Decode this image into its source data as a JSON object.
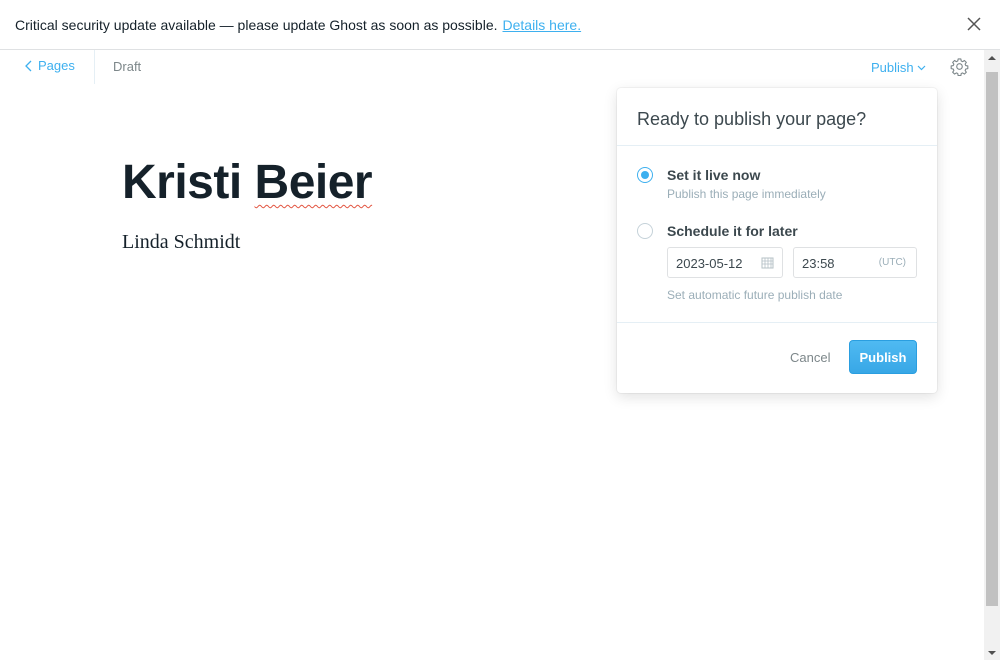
{
  "notice": {
    "text": "Critical security update available — please update Ghost as soon as possible.",
    "link": "Details here.",
    "close_icon": "close-icon"
  },
  "header": {
    "back_label": "Pages",
    "status": "Draft",
    "publish_label": "Publish",
    "settings_icon": "gear-icon"
  },
  "editor": {
    "title_part1": "Kristi ",
    "title_part2": "Beier",
    "body": "Linda Schmidt"
  },
  "popover": {
    "title": "Ready to publish your page?",
    "options": [
      {
        "label": "Set it live now",
        "description": "Publish this page immediately",
        "selected": true
      },
      {
        "label": "Schedule it for later",
        "description": "",
        "selected": false
      }
    ],
    "date_value": "2023-05-12",
    "time_value": "23:58",
    "timezone": "(UTC)",
    "schedule_hint": "Set automatic future publish date",
    "cancel_label": "Cancel",
    "publish_label": "Publish"
  },
  "colors": {
    "accent": "#3eb0ef",
    "text": "#15212a",
    "muted": "#9baeb8"
  }
}
